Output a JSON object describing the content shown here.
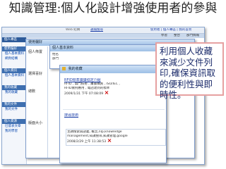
{
  "slide_title": "知識管理:個人化設計增強使用者的參與",
  "back_window": {
    "menu": [
      "Web 結構",
      "通報搜尋"
    ],
    "user_line": "使用者 | 個人專區 | 我的首頁",
    "tabs": [
      "學習",
      "整合",
      "部門情報"
    ],
    "sidebar_title": "個人專區",
    "sidebar_sections": [
      {
        "head": "使用偏好",
        "items": [
          "個人基本資料",
          "網頁結構"
        ]
      },
      {
        "head": "個人資訊",
        "items": [
          "個人基本資料"
        ]
      },
      {
        "head": "我的收藏",
        "items": [
          "我的收藏"
        ]
      },
      {
        "head": "我的文件",
        "items": [
          "我的文件"
        ]
      },
      {
        "head": "個人資源",
        "items": [
          "已發表文章",
          "我的學習"
        ]
      }
    ],
    "mid_header": "使用偏好",
    "mid_labels": [
      "個人佈置",
      "選擇喜好",
      "總數",
      "版面大小"
    ]
  },
  "profile_window": {
    "header": "個人基本資料",
    "fields": [
      "姓名",
      "部門",
      "電話"
    ]
  },
  "front_window": {
    "header": "我的收藏",
    "item1": {
      "title": "RFID標準議議協定介紹",
      "line1": "RFID , 無門技術 , 蕭書購買 , ISO/IEC ,",
      "line2": "RFID實例應用 , 電話達到的標準",
      "date": "2009/1/31 下午 07:08:09"
    },
    "item2": {
      "title": "搜尋技術",
      "line1": "主題搜索與語義, 概念,nlp,knowledge",
      "line2": "management,知識搜尋,知識管理,google",
      "date": "2008/2/29 上午 11:38:53"
    }
  },
  "callout": {
    "text": "利用個人收藏來減少文件列印,確保資訊取的便利性與即時性。"
  }
}
